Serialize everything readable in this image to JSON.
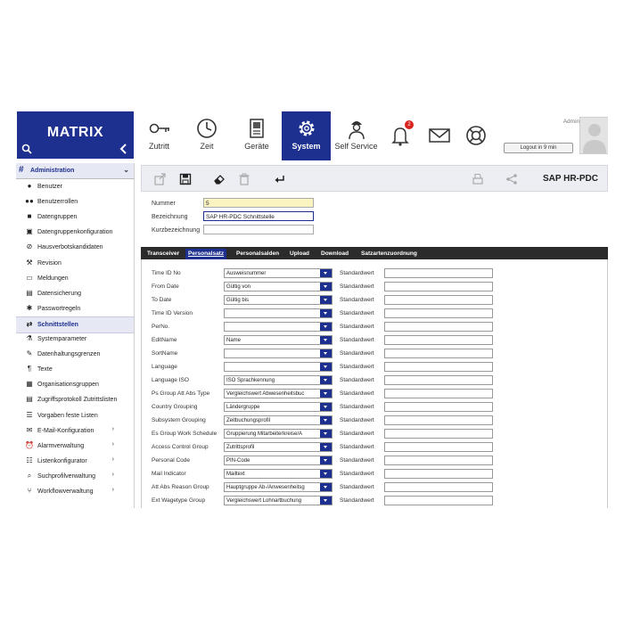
{
  "app": {
    "logo": "MATRIX"
  },
  "nav": [
    {
      "label": "Zutritt",
      "icon": "key-icon"
    },
    {
      "label": "Zeit",
      "icon": "clock-icon"
    },
    {
      "label": "Geräte",
      "icon": "device-icon"
    },
    {
      "label": "System",
      "icon": "gear-icon",
      "active": true
    },
    {
      "label": "Self Service",
      "icon": "worker-icon"
    },
    {
      "label": "",
      "icon": "bell-icon"
    },
    {
      "label": "",
      "icon": "mail-icon"
    },
    {
      "label": "",
      "icon": "lifebuoy-icon"
    }
  ],
  "notifications": {
    "count": "2"
  },
  "user": {
    "role": "Administrator",
    "name": "admin",
    "logout_label": "Logout in 9 min"
  },
  "sidebar": {
    "section": "Administration",
    "items": [
      {
        "label": "Benutzer",
        "icon": "user-icon"
      },
      {
        "label": "Benutzerrollen",
        "icon": "users-icon"
      },
      {
        "label": "Datengruppen",
        "icon": "cube-icon"
      },
      {
        "label": "Datengruppenkonfiguration",
        "icon": "config-icon"
      },
      {
        "label": "Hausverbotskandidaten",
        "icon": "ban-icon"
      },
      {
        "label": "Revision",
        "icon": "hammer-icon"
      },
      {
        "label": "Meldungen",
        "icon": "message-icon"
      },
      {
        "label": "Datensicherung",
        "icon": "backup-icon"
      },
      {
        "label": "Passwortregeln",
        "icon": "asterisk-icon"
      },
      {
        "label": "Schnittstellen",
        "icon": "exchange-icon",
        "active": true
      },
      {
        "label": "Systemparameter",
        "icon": "flask-icon"
      },
      {
        "label": "Datenhaltungsgrenzen",
        "icon": "pencil-icon"
      },
      {
        "label": "Texte",
        "icon": "paragraph-icon"
      },
      {
        "label": "Organisationsgruppen",
        "icon": "org-icon"
      },
      {
        "label": "Zugriffsprotokoll Zutrittslisten",
        "icon": "log-icon"
      },
      {
        "label": "Vorgaben feste Listen",
        "icon": "list-icon"
      },
      {
        "label": "E-Mail-Konfiguration",
        "icon": "email-icon",
        "has_children": true
      },
      {
        "label": "Alarmverwaltung",
        "icon": "alarm-icon",
        "has_children": true
      },
      {
        "label": "Listenkonfigurator",
        "icon": "listconfig-icon",
        "has_children": true
      },
      {
        "label": "Suchprofilverwaltung",
        "icon": "search-profile-icon",
        "has_children": true
      },
      {
        "label": "Workflowverwaltung",
        "icon": "workflow-icon",
        "has_children": true
      }
    ]
  },
  "toolbar": {
    "title": "SAP HR-PDC"
  },
  "form": {
    "nummer_label": "Nummer",
    "nummer_value": "5",
    "bezeichnung_label": "Bezeichnung",
    "bezeichnung_value": "SAP HR-PDC Schnittstelle",
    "kurz_label": "Kurzbezeichnung",
    "kurz_value": ""
  },
  "tabs": [
    "Transceiver",
    "Personalsatz",
    "Personalsalden",
    "Upload",
    "Download",
    "Satzartenzuordnung"
  ],
  "active_tab": "Personalsatz",
  "default_label": "Standardwert",
  "rows": [
    {
      "label": "Time ID No",
      "value": "Ausweisnummer"
    },
    {
      "label": "From Date",
      "value": "Gültig von"
    },
    {
      "label": "To Date",
      "value": "Gültig bis"
    },
    {
      "label": "Time ID Version",
      "value": ""
    },
    {
      "label": "PerNo.",
      "value": ""
    },
    {
      "label": "EditName",
      "value": "Name"
    },
    {
      "label": "SortName",
      "value": ""
    },
    {
      "label": "Language",
      "value": ""
    },
    {
      "label": "Language ISO",
      "value": "ISO Sprachkennung"
    },
    {
      "label": "Ps Group Att Abs Type",
      "value": "Vergleichswert Abwesenheitsbuc"
    },
    {
      "label": "Country Grouping",
      "value": "Ländergruppe"
    },
    {
      "label": "Subsystem Grouping",
      "value": "Zeitbuchungsprofil"
    },
    {
      "label": "Es Group Work Schedule",
      "value": "Gruppierung Mitarbeiterkreise/A"
    },
    {
      "label": "Access Control Group",
      "value": "Zutrittsprofil"
    },
    {
      "label": "Personal Code",
      "value": "PIN-Code"
    },
    {
      "label": "Mail Indicator",
      "value": "Mailtext"
    },
    {
      "label": "Att Abs Reason Group",
      "value": "Hauptgruppe Ab-/Anwesenheitsg"
    },
    {
      "label": "Ext Wagetype Group",
      "value": "Vergleichswert Lohnartbuchung"
    }
  ]
}
